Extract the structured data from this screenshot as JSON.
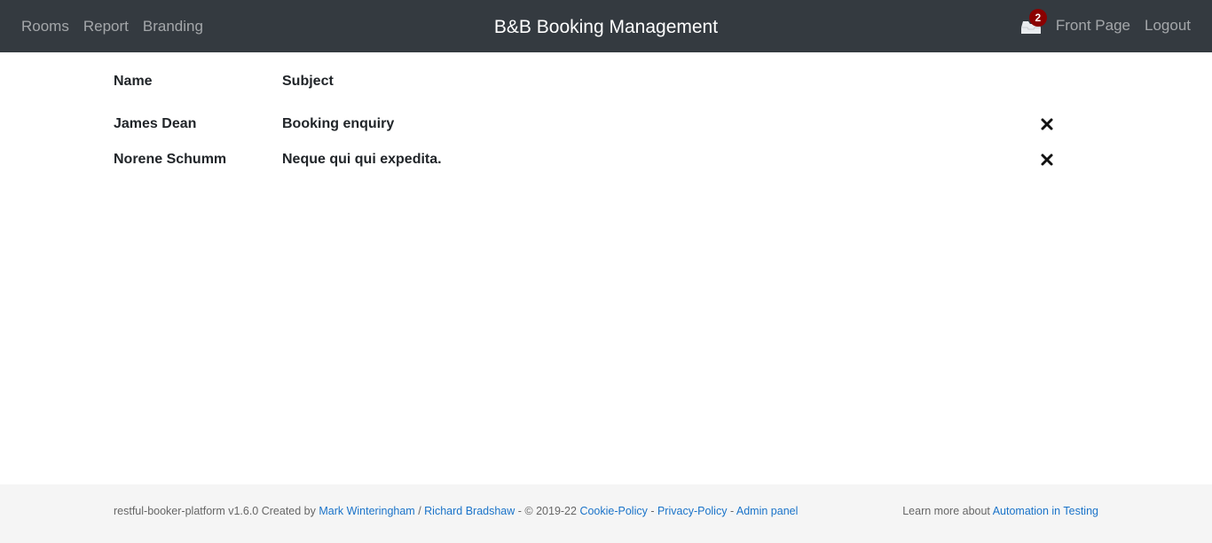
{
  "nav": {
    "links": [
      "Rooms",
      "Report",
      "Branding"
    ],
    "title": "B&B Booking Management",
    "inbox_count": "2",
    "front_page": "Front Page",
    "logout": "Logout"
  },
  "messages": {
    "headers": {
      "name": "Name",
      "subject": "Subject"
    },
    "rows": [
      {
        "name": "James Dean",
        "subject": "Booking enquiry"
      },
      {
        "name": "Norene Schumm",
        "subject": "Neque qui qui expedita."
      }
    ],
    "delete_icon": "close-icon"
  },
  "footer": {
    "prefix": "restful-booker-platform v1.6.0 Created by ",
    "author1": "Mark Winteringham",
    "sep1": " / ",
    "author2": "Richard Bradshaw",
    "copyright": " - © 2019-22 ",
    "cookie": "Cookie-Policy",
    "dash1": " - ",
    "privacy": "Privacy-Policy",
    "dash2": " - ",
    "admin": "Admin panel",
    "learn_prefix": "Learn more about ",
    "learn_link": "Automation in Testing"
  },
  "colors": {
    "navbar": "#343a40",
    "badge": "#8b0000",
    "link": "#1a73c9",
    "footer_bg": "#f5f5f5"
  }
}
